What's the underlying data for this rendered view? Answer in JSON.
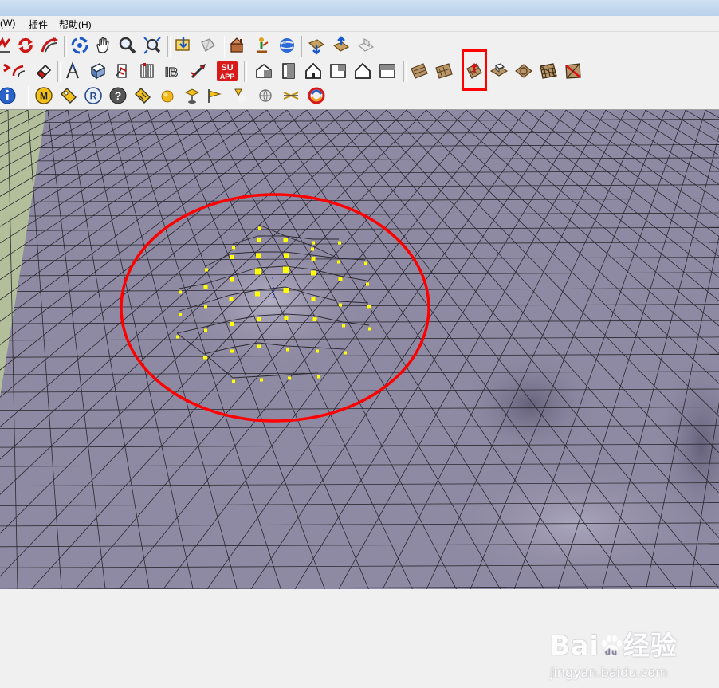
{
  "menu": {
    "items": [
      {
        "label": "(W)"
      },
      {
        "label": "插件"
      },
      {
        "label": "帮助(H)"
      }
    ]
  },
  "toolbar_row1": {
    "buttons": [
      {
        "icon": "freehand-icon"
      },
      {
        "icon": "rotate-icon"
      },
      {
        "icon": "follow-me-icon"
      },
      {
        "icon": "orbit-icon"
      },
      {
        "icon": "pan-hand-icon"
      },
      {
        "icon": "zoom-icon"
      },
      {
        "icon": "zoom-extents-icon"
      },
      {
        "icon": "get-models-icon"
      },
      {
        "icon": "share-model-icon"
      },
      {
        "icon": "component-share-icon"
      },
      {
        "icon": "extension-icon"
      },
      {
        "icon": "google-earth-icon"
      },
      {
        "icon": "get-current-view-icon"
      },
      {
        "icon": "toggle-terrain-icon"
      },
      {
        "icon": "place-model-icon"
      }
    ]
  },
  "toolbar_row2": {
    "buttons": [
      {
        "icon": "push-pull-icon"
      },
      {
        "icon": "offset-icon"
      },
      {
        "icon": "eraser-icon"
      },
      {
        "icon": "tape-measure-icon"
      },
      {
        "icon": "dimension-icon"
      },
      {
        "icon": "protractor-icon"
      },
      {
        "icon": "text-icon"
      },
      {
        "icon": "3d-text-icon"
      },
      {
        "icon": "paint-bucket-icon"
      },
      {
        "icon": "su-app-icon",
        "text_top": "SU",
        "text_bottom": "APP"
      },
      {
        "icon": "iso-view-icon"
      },
      {
        "icon": "front-door-view-icon"
      },
      {
        "icon": "house-front-view-icon"
      },
      {
        "icon": "top-view-icon"
      },
      {
        "icon": "house-outline-icon"
      },
      {
        "icon": "back-view-icon"
      },
      {
        "icon": "sandbox-contours-icon"
      },
      {
        "icon": "sandbox-scratch-icon"
      },
      {
        "icon": "sandbox-smoove-icon"
      },
      {
        "icon": "sandbox-stamp-icon"
      },
      {
        "icon": "sandbox-drape-icon"
      },
      {
        "icon": "sandbox-add-detail-icon"
      },
      {
        "icon": "sandbox-flip-edge-icon"
      }
    ],
    "highlighted_button": "sandbox-smoove-icon"
  },
  "toolbar_row3": {
    "buttons": [
      {
        "icon": "info-icon"
      },
      {
        "icon": "m-plugin-icon",
        "text": "M"
      },
      {
        "icon": "tag-plugin-icon"
      },
      {
        "icon": "r-plugin-icon",
        "text": "R"
      },
      {
        "icon": "help-icon",
        "text": "?"
      },
      {
        "icon": "tag-plugin-2-icon"
      },
      {
        "icon": "sphere-icon"
      },
      {
        "icon": "sun-light-icon"
      },
      {
        "icon": "flag-light-icon"
      },
      {
        "icon": "lamp-light-icon"
      },
      {
        "icon": "globe-light-icon"
      },
      {
        "icon": "crossed-lines-icon"
      },
      {
        "icon": "render-swirl-icon"
      }
    ]
  },
  "colors": {
    "terrain": "#8f8aa3",
    "terrain_grid": "#2a2830",
    "ground_side": "#b3bf9a",
    "selection_vertex": "#ffff00",
    "annotation_red": "#ff0000"
  },
  "watermark": {
    "brand": "Bai",
    "brand_cn": "经验",
    "url": "jingyan.baidu.com"
  }
}
